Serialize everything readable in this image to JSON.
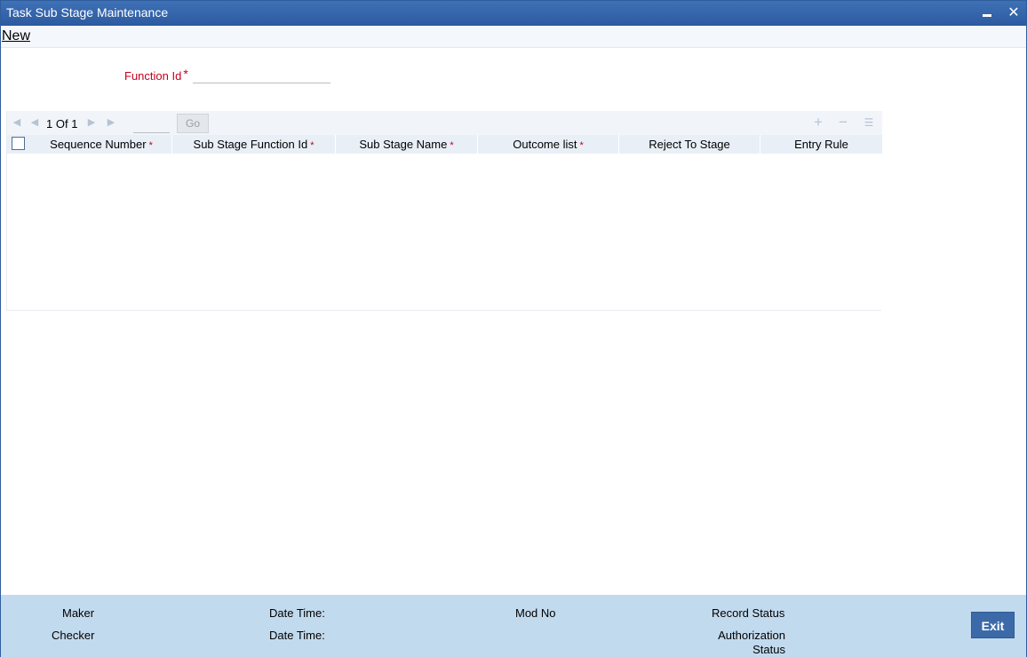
{
  "window": {
    "title": "Task Sub Stage Maintenance",
    "close_glyph": "✕"
  },
  "toolbar": {
    "new_label": "New"
  },
  "form": {
    "function_id_label": "Function Id",
    "required_mark": "*",
    "function_id_value": ""
  },
  "grid": {
    "page_current": "1",
    "page_of": "Of",
    "page_total": "1",
    "go_label": "Go",
    "add_glyph": "+",
    "delete_glyph": "−",
    "columns": [
      {
        "label": "Sequence Number",
        "required": "*"
      },
      {
        "label": "Sub Stage Function Id",
        "required": "*"
      },
      {
        "label": "Sub Stage Name",
        "required": "*"
      },
      {
        "label": "Outcome list",
        "required": "*"
      },
      {
        "label": "Reject To Stage",
        "required": ""
      },
      {
        "label": "Entry Rule",
        "required": ""
      }
    ],
    "rows": []
  },
  "footer": {
    "maker": "Maker",
    "checker": "Checker",
    "date_time_1": "Date Time:",
    "date_time_2": "Date Time:",
    "mod_no": "Mod No",
    "record_status": "Record Status",
    "authorization_status": "Authorization Status",
    "exit_label": "Exit"
  },
  "colors": {
    "title_bar": "#2c5aa0",
    "required": "#c4001d",
    "footer": "#c2daee",
    "exit_button": "#3c6aa9"
  }
}
